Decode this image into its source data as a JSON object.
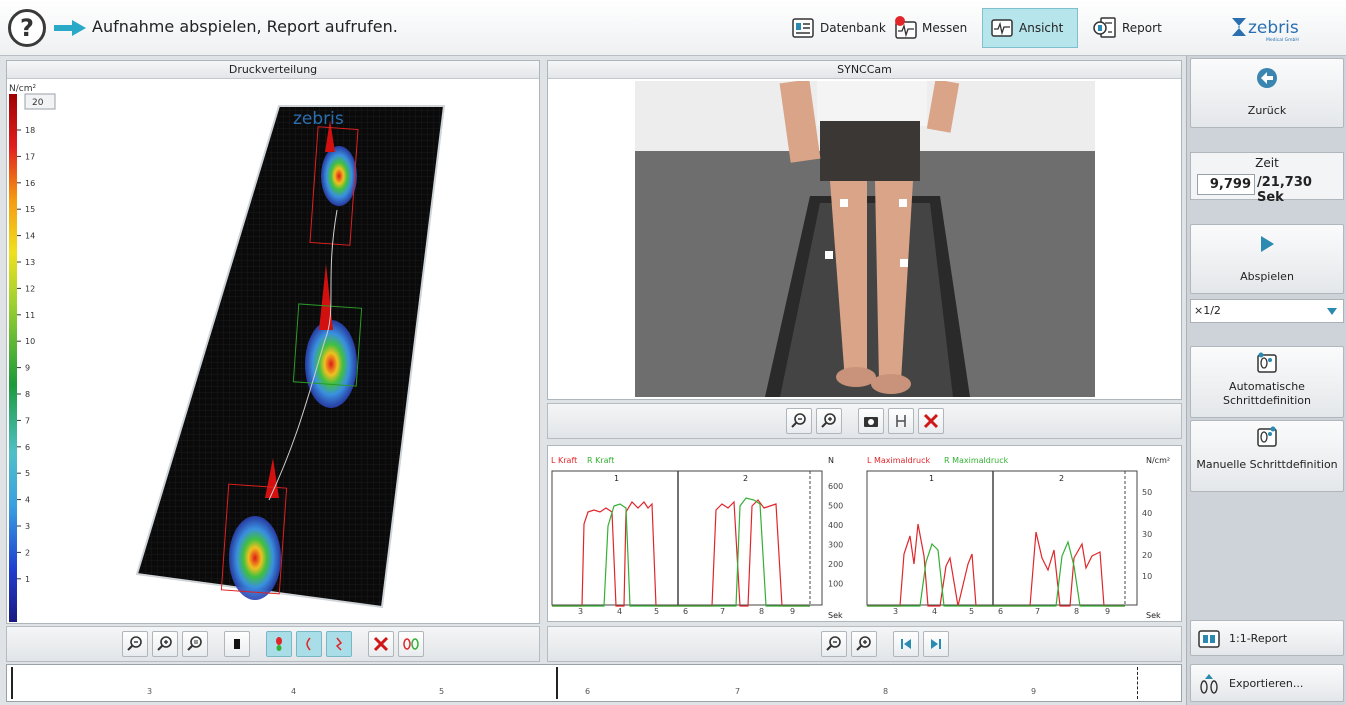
{
  "header": {
    "instruction": "Aufnahme abspielen, Report aufrufen.",
    "nav": [
      {
        "label": "Datenbank",
        "icon": "database-icon",
        "active": false
      },
      {
        "label": "Messen",
        "icon": "measure-icon",
        "active": false
      },
      {
        "label": "Ansicht",
        "icon": "view-icon",
        "active": true
      },
      {
        "label": "Report",
        "icon": "report-icon",
        "active": false
      }
    ],
    "logo_text": "zebris",
    "logo_sub": "Medical GmbH"
  },
  "pressure_panel": {
    "title": "Druckverteilung",
    "unit": "N/cm²",
    "max_value": "20",
    "scale_ticks": [
      "18",
      "17",
      "16",
      "15",
      "14",
      "13",
      "12",
      "11",
      "10",
      "9",
      "8",
      "7",
      "6",
      "5",
      "4",
      "3",
      "2",
      "1"
    ],
    "plate_logo": "zebris"
  },
  "camera_panel": {
    "title": "SYNCCam"
  },
  "force_chart": {
    "legend_left": "L Kraft",
    "legend_right": "R Kraft",
    "unit": "N",
    "steps": [
      "1",
      "2"
    ],
    "y_ticks": [
      "600",
      "500",
      "400",
      "300",
      "200",
      "100"
    ],
    "x_ticks": [
      "3",
      "4",
      "5",
      "6",
      "7",
      "8",
      "9"
    ],
    "x_unit": "Sek"
  },
  "pressure_chart": {
    "legend_left": "L Maximaldruck",
    "legend_right": "R Maximaldruck",
    "unit": "N/cm²",
    "steps": [
      "1",
      "2"
    ],
    "y_ticks": [
      "50",
      "40",
      "30",
      "20",
      "10"
    ],
    "x_ticks": [
      "3",
      "4",
      "5",
      "6",
      "7",
      "8",
      "9"
    ],
    "x_unit": "Sek"
  },
  "sidebar": {
    "back_label": "Zurück",
    "time_label": "Zeit",
    "time_current": "9,799",
    "time_total": "/21,730 Sek",
    "play_label": "Abspielen",
    "speed_value": "×1/2",
    "auto_step_label": "Automatische Schrittdefinition",
    "manual_step_label": "Manuelle Schrittdefinition",
    "report_label": "1:1-Report",
    "export_label": "Exportieren..."
  },
  "timeline": {
    "ticks": [
      "3",
      "4",
      "5",
      "6",
      "7",
      "8",
      "9"
    ]
  },
  "colors": {
    "left_series": "#e0262a",
    "right_series": "#33b033",
    "accent": "#2a8ab0",
    "active_tab": "#b7e5ec"
  }
}
